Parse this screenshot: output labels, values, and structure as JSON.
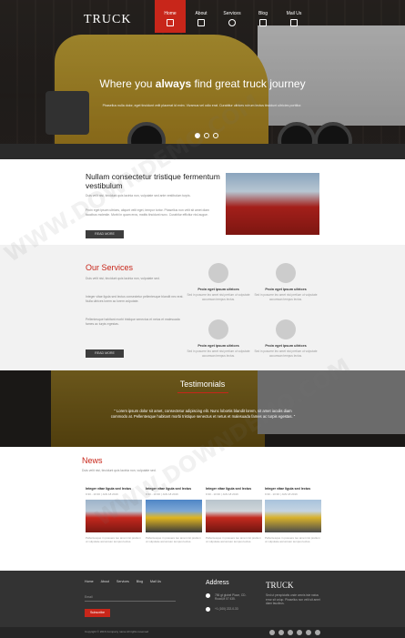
{
  "header": {
    "logo": "TRUCK",
    "nav": [
      {
        "label": "Home",
        "active": true
      },
      {
        "label": "About",
        "active": false
      },
      {
        "label": "Services",
        "active": false
      },
      {
        "label": "Blog",
        "active": false
      },
      {
        "label": "Mail Us",
        "active": false
      }
    ]
  },
  "hero": {
    "title_pre": "Where you",
    "title_bold": "always",
    "title_post": "find great truck journey",
    "subtitle": "Phasellus nulla dolor, eget tincidunt velit placerat id enim. Vivamus vel odio erat. Curabitur ultrices rutrum lectus tincidunt ultricies porttitor.",
    "slides": 3,
    "active_slide": 0
  },
  "intro": {
    "title": "Nullam consectetur tristique fermentum vestibulum",
    "text1": "Duis velit nisi, tincidunt quis lacinia non, vulputate sed ante vestibulum turpis.",
    "text2": "Proin eget ipsum ultrices, aliquet velit eget, tempor tortor. Phasellus non velit sit amet diam faucibus molestie. Morbi in quam eros, mattis tincidunt nunc. Curabitur efficitur nisl augue.",
    "button": "READ MORE"
  },
  "services": {
    "title": "Our Services",
    "intro": "Duis velit nisi, tincidunt quis lacinia non, vulputate sed.",
    "text1": "Integer vitae ligula sed lectus consectetur pellentesque blandit nec erat. Nulla ultrices lorem ac lorem vulputate.",
    "text2": "Pellentesque habitant morbi tristique senectus et netus et malesuada fames ac turpis egestas.",
    "button": "READ MORE",
    "items": [
      {
        "title": "Proin eget ipsum ultrices",
        "text": "Sed in posuere leo amet nisi pretium ut vulputate accumsan tempus lectus."
      },
      {
        "title": "Proin eget ipsum ultrices",
        "text": "Sed in posuere leo amet nisi pretium ut vulputate accumsan tempus lectus."
      },
      {
        "title": "Proin eget ipsum ultrices",
        "text": "Sed in posuere leo amet nisi pretium ut vulputate accumsan tempus lectus."
      },
      {
        "title": "Proin eget ipsum ultrices",
        "text": "Sed in posuere leo amet nisi pretium ut vulputate accumsan tempus lectus."
      }
    ]
  },
  "testimonials": {
    "title": "Testimonials",
    "quote": "\" Lorem ipsum dolor sit amet, consectetur adipiscing elit. Nunc lobortis blandit lorem, sit amet iaculis diam commodo at. Pellentesque habitant morbi tristique senectus et netus et malesuada fames ac turpis egestas. \""
  },
  "news": {
    "title": "News",
    "intro": "Duis velit nisi, tincidunt quis lacinia non, vulputate sed.",
    "items": [
      {
        "title": "Integer vitae ligula sed lectus",
        "date": "9:30 - 10:30 | JAN 18 2016",
        "text": "Pellentesque in posuere leo amet nisi pretium ut vulputate accumsan tempus lectus."
      },
      {
        "title": "Integer vitae ligula sed lectus",
        "date": "9:30 - 10:30 | JAN 18 2016",
        "text": "Pellentesque in posuere leo amet nisi pretium ut vulputate accumsan tempus lectus."
      },
      {
        "title": "Integer vitae ligula sed lectus",
        "date": "9:30 - 10:30 | JAN 18 2016",
        "text": "Pellentesque in posuere leo amet nisi pretium ut vulputate accumsan tempus lectus."
      },
      {
        "title": "Integer vitae ligula sed lectus",
        "date": "9:30 - 10:30 | JAN 18 2016",
        "text": "Pellentesque in posuere leo amet nisi pretium ut vulputate accumsan tempus lectus."
      }
    ]
  },
  "footer": {
    "links": [
      "Home",
      "About",
      "Services",
      "Blog",
      "Mail Us"
    ],
    "email_placeholder": "Email",
    "subscribe": "Subscribe",
    "address_title": "Address",
    "address": "756 gt globel Place, CD-Road,M 07 435.",
    "phone": "+1 (100) 222-0-33",
    "logo": "TRUCK",
    "about": "Sed ut perspiciatis unde omnis iste natus error sit volup. Phasellus non velit sit amet diam faucibus."
  },
  "bottom": {
    "copyright": "Copyright © 2016 Company name All rights reserved"
  },
  "watermark": "WWW.DOWNDEMO.COM",
  "colors": {
    "accent": "#c8261a",
    "dark": "#333333"
  }
}
